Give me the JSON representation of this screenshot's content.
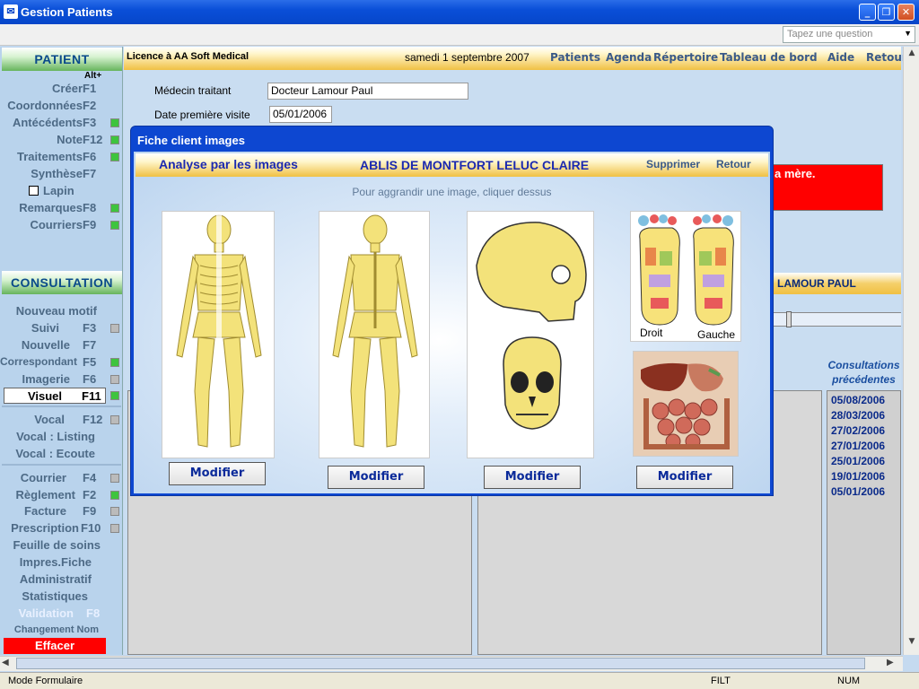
{
  "window": {
    "title": "Gestion Patients",
    "title_icon": "app-icon",
    "minimize": "_",
    "maximize": "❐",
    "close": "✕"
  },
  "question_box": {
    "placeholder": "Tapez une question"
  },
  "header": {
    "licence": "Licence à  AA Soft Medical",
    "date": "samedi 1 septembre 2007",
    "nav": [
      "Patients",
      "Agenda",
      "Répertoire",
      "Tableau de bord",
      "Aide",
      "Retour"
    ]
  },
  "patient_section": {
    "title": "PATIENT",
    "alt_label": "Alt+",
    "items": [
      {
        "label": "Créer",
        "key": "F1",
        "status": ""
      },
      {
        "label": "Coordonnées",
        "key": "F2",
        "status": ""
      },
      {
        "label": "Antécédents",
        "key": "F3",
        "status": "green"
      },
      {
        "label": "Note",
        "key": "F12",
        "status": "green"
      },
      {
        "label": "Traitements",
        "key": "F6",
        "status": "green"
      },
      {
        "label": "Synthèse",
        "key": "F7",
        "status": ""
      },
      {
        "label": "Lapin",
        "key": "",
        "status": "checkbox"
      },
      {
        "label": "Remarques",
        "key": "F8",
        "status": "green"
      },
      {
        "label": "Courriers",
        "key": "F9",
        "status": "green"
      }
    ]
  },
  "consultation_section": {
    "title": "CONSULTATION",
    "items": [
      {
        "label": "Nouveau motif",
        "key": "",
        "status": ""
      },
      {
        "label": "Suivi",
        "key": "F3",
        "status": "grey"
      },
      {
        "label": "Nouvelle",
        "key": "F7",
        "status": ""
      },
      {
        "label": "Correspondant",
        "key": "F5",
        "status": "green"
      },
      {
        "label": "Imagerie",
        "key": "F6",
        "status": "grey"
      },
      {
        "label": "Visuel",
        "key": "F11",
        "status": "green"
      },
      {
        "label": "Vocal",
        "key": "F12",
        "status": "grey"
      },
      {
        "label": "Vocal : Listing",
        "key": "",
        "status": ""
      },
      {
        "label": "Vocal : Ecoute",
        "key": "",
        "status": ""
      },
      {
        "label": "Courrier",
        "key": "F4",
        "status": "grey"
      },
      {
        "label": "Règlement",
        "key": "F2",
        "status": "green"
      },
      {
        "label": "Facture",
        "key": "F9",
        "status": "grey"
      },
      {
        "label": "Prescription",
        "key": "F10",
        "status": "grey"
      },
      {
        "label": "Feuille de soins",
        "key": "",
        "status": ""
      },
      {
        "label": "Impres.Fiche",
        "key": "",
        "status": ""
      },
      {
        "label": "Administratif",
        "key": "",
        "status": ""
      },
      {
        "label": "Statistiques",
        "key": "",
        "status": ""
      },
      {
        "label": "Validation",
        "key": "F8",
        "status": ""
      },
      {
        "label": "Changement Nom",
        "key": "",
        "status": ""
      },
      {
        "label": "Effacer",
        "key": "",
        "status": ""
      }
    ]
  },
  "form": {
    "medecin_label": "Médecin traitant",
    "medecin_value": "Docteur Lamour Paul",
    "date_label": "Date première visite",
    "date_value": "05/01/2006",
    "alert_text": "a mère.",
    "doctor_banner": "LAMOUR PAUL"
  },
  "consultations": {
    "title_line1": "Consultations",
    "title_line2": "précédentes",
    "dates": [
      "05/08/2006",
      "28/03/2006",
      "27/02/2006",
      "27/01/2006",
      "25/01/2006",
      "19/01/2006",
      "05/01/2006"
    ]
  },
  "dialog": {
    "title": "Fiche client images",
    "heading": "Analyse par les images",
    "patient_name": "ABLIS DE MONTFORT LELUC CLAIRE",
    "delete_label": "Supprimer",
    "back_label": "Retour",
    "hint": "Pour aggrandir une image, cliquer dessus",
    "foot_left_label": "Droit",
    "foot_right_label": "Gauche",
    "modify_label": "Modifier"
  },
  "status_bar": {
    "mode": "Mode Formulaire",
    "filt": "FILT",
    "num": "NUM"
  },
  "colors": {
    "title_blue": "#0646c9",
    "green_header": "#66b45c",
    "accent_red": "#ff0000",
    "dialog_blue": "#0d47d1",
    "yellow_bar": "#f0c043"
  }
}
